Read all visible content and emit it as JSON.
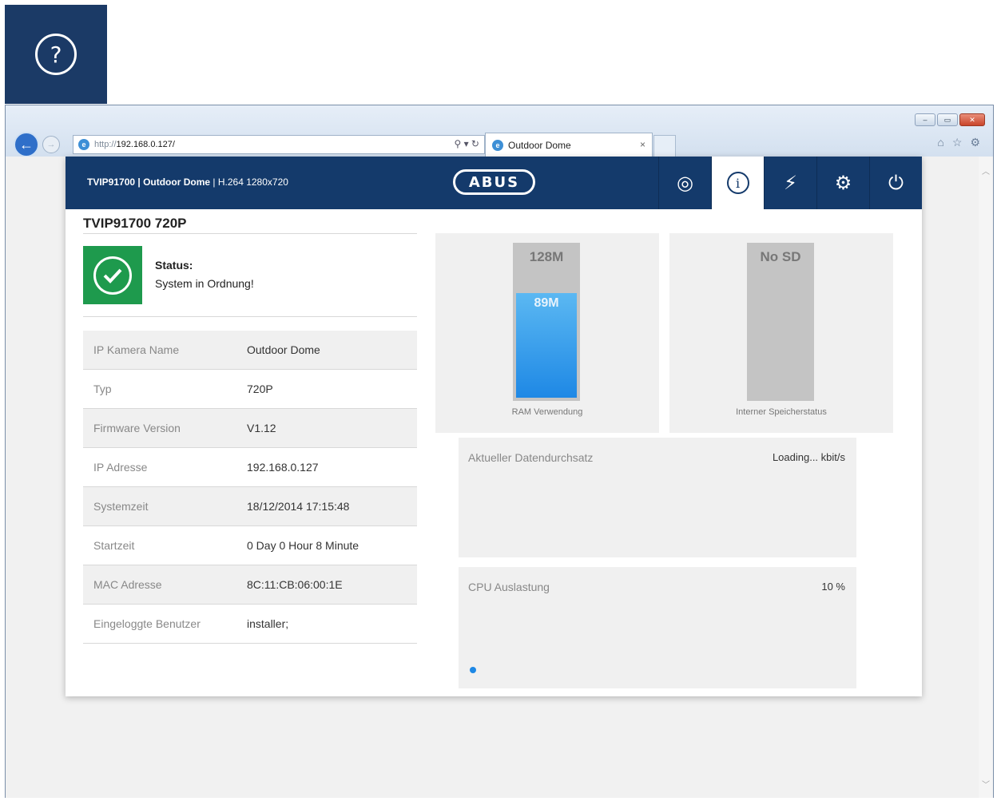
{
  "browser": {
    "url_prefix": "http://",
    "url_host": "192.168.0.127/",
    "tab_title": "Outdoor Dome"
  },
  "header": {
    "model": "TVIP91700 | Outdoor Dome",
    "stream": "| H.264 1280x720",
    "logo": "ABUS",
    "accent": "#143a6b"
  },
  "main": {
    "page_title": "TVIP91700 720P",
    "status_label": "Status:",
    "status_text": "System in Ordnung!",
    "status_color": "#1e9a4d",
    "info_rows": [
      {
        "key": "IP Kamera Name",
        "value": "Outdoor Dome"
      },
      {
        "key": "Typ",
        "value": "720P"
      },
      {
        "key": "Firmware Version",
        "value": "V1.12"
      },
      {
        "key": "IP Adresse",
        "value": "192.168.0.127"
      },
      {
        "key": "Systemzeit",
        "value": "18/12/2014 17:15:48"
      },
      {
        "key": "Startzeit",
        "value": "0 Day 0 Hour 8 Minute"
      },
      {
        "key": "MAC Adresse",
        "value": "8C:11:CB:06:00:1E"
      },
      {
        "key": "Eingeloggte Benutzer",
        "value": "installer;"
      }
    ]
  },
  "ram": {
    "total_label": "128M",
    "used_label": "89M",
    "used_fraction": 0.69,
    "caption": "RAM Verwendung"
  },
  "sd": {
    "label": "No SD",
    "caption": "Interner Speicherstatus"
  },
  "throughput": {
    "title": "Aktueller Datendurchsatz",
    "value": "Loading... kbit/s"
  },
  "cpu": {
    "title": "CPU Auslastung",
    "value": "10 %"
  }
}
